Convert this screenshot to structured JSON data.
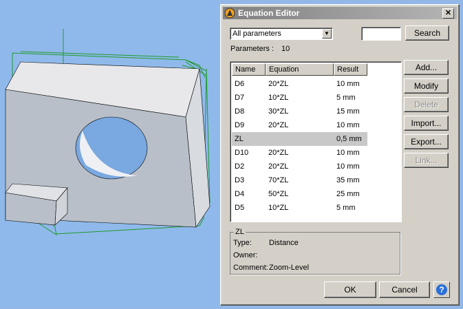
{
  "dialog": {
    "title": "Equation Editor",
    "filter_select": {
      "value": "All parameters",
      "arrow_icon": "dropdown-arrow-icon"
    },
    "search": {
      "value": "",
      "button_label": "Search"
    },
    "parameters_label": "Parameters :",
    "parameters_count": "10",
    "columns": [
      "Name",
      "Equation",
      "Result"
    ],
    "rows": [
      {
        "name": "D6",
        "equation": "20*ZL",
        "result": "10 mm",
        "selected": false
      },
      {
        "name": "D7",
        "equation": "10*ZL",
        "result": "5 mm",
        "selected": false
      },
      {
        "name": "D8",
        "equation": "30*ZL",
        "result": "15 mm",
        "selected": false
      },
      {
        "name": "D9",
        "equation": "20*ZL",
        "result": "10 mm",
        "selected": false
      },
      {
        "name": "ZL",
        "equation": "",
        "result": "0,5 mm",
        "selected": true
      },
      {
        "name": "D10",
        "equation": "20*ZL",
        "result": "10 mm",
        "selected": false
      },
      {
        "name": "D2",
        "equation": "20*ZL",
        "result": "10 mm",
        "selected": false
      },
      {
        "name": "D3",
        "equation": "70*ZL",
        "result": "35 mm",
        "selected": false
      },
      {
        "name": "D4",
        "equation": "50*ZL",
        "result": "25 mm",
        "selected": false
      },
      {
        "name": "D5",
        "equation": "10*ZL",
        "result": "5 mm",
        "selected": false
      }
    ],
    "side_buttons": {
      "add": "Add...",
      "modify": "Modify",
      "delete": "Delete",
      "import": "Import...",
      "export": "Export...",
      "link": "Link..."
    },
    "details": {
      "group_title": "ZL",
      "type_label": "Type:",
      "type_value": "Distance",
      "owner_label": "Owner:",
      "owner_value": "",
      "comment_label": "Comment:",
      "comment_value": "Zoom-Level"
    },
    "ok_label": "OK",
    "cancel_label": "Cancel",
    "help_symbol": "?",
    "close_symbol": "✕"
  },
  "colors": {
    "viewport_bg": "#8fb9eb",
    "dialog_bg": "#d4d0c8",
    "selection": "#c8c8c8",
    "model_lines": "#1f9a2a"
  }
}
